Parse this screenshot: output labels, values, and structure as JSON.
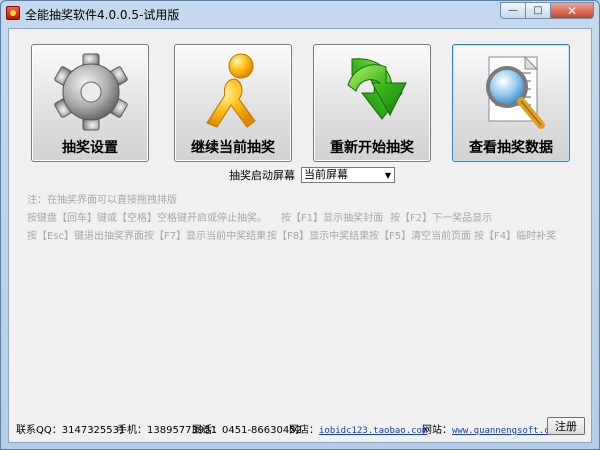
{
  "window": {
    "title": "全能抽奖软件4.0.0.5-试用版"
  },
  "buttons": [
    {
      "label": "抽奖设置",
      "icon": "gear-icon"
    },
    {
      "label": "继续当前抽奖",
      "icon": "running-person-icon"
    },
    {
      "label": "重新开始抽奖",
      "icon": "green-arrow-icon"
    },
    {
      "label": "查看抽奖数据",
      "icon": "magnifier-document-icon"
    }
  ],
  "screen": {
    "label": "抽奖启动屏幕",
    "selected": "当前屏幕"
  },
  "hints": {
    "line1": "注：在抽奖界面可以直接拖拽排版",
    "line2a": "按键盘【回车】键或【空格】空格键开启或停止抽奖。",
    "line2b": "按【F1】显示抽奖封面",
    "line2c": "按【F2】下一奖品显示",
    "line3a": "按【Esc】键退出抽奖界面",
    "line3b": "按【F7】显示当前中奖结果",
    "line3c": "按【F8】显示中奖结果",
    "line3d": "按【F5】清空当前页面",
    "line3e": "按【F4】临时补奖"
  },
  "footer": {
    "qq_label": "联系QQ：",
    "qq": "3147325531",
    "phone_label": "手机：",
    "phone": "13895773951",
    "tel_label": "固话：",
    "tel": "0451-86630452",
    "shop_label": "网店：",
    "shop": "iobidc123.taobao.com",
    "site_label": "网站：",
    "site": "www.quannengsoft.cn",
    "register": "注册"
  },
  "colors": {
    "hint": "#a8a8a8",
    "link": "#1a3ea8",
    "frame": "#b4cce6"
  }
}
